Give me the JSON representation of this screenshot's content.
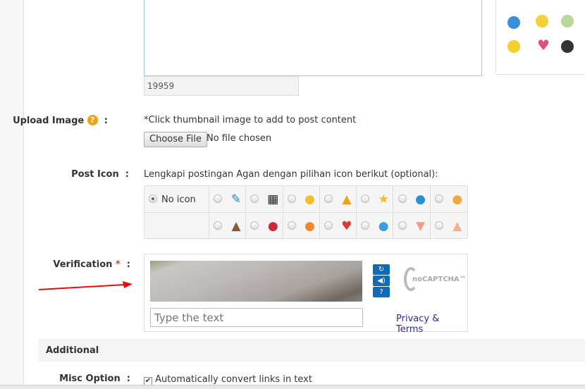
{
  "editor": {
    "char_count": "19959"
  },
  "upload": {
    "label": "Upload Image",
    "help": "?",
    "colon": ":",
    "hint": "*Click thumbnail image to add to post content",
    "button": "Choose File",
    "status": "No file chosen"
  },
  "post_icon": {
    "label": "Post Icon",
    "colon": ":",
    "hint": "Lengkapi postingan Agan dengan pilihan icon berikut (optional):",
    "no_icon": "No icon",
    "row1": [
      "pencil-icon",
      "clapper-icon",
      "lightbulb-icon",
      "warning-icon",
      "star-icon",
      "cool-face-icon",
      "smile-face-icon"
    ],
    "row2": [
      "poop-icon",
      "clown-face-icon",
      "laugh-face-icon",
      "heart-icon",
      "grin-face-icon",
      "thumbs-down-icon",
      "thumbs-up-icon"
    ]
  },
  "verification": {
    "label": "Verification",
    "required": "*",
    "colon": ":",
    "placeholder": "Type the text",
    "privacy": "Privacy & Terms",
    "brand": "noCAPTCHA™",
    "refresh": "↻",
    "audio": "◀)",
    "help": "?"
  },
  "additional": {
    "title": "Additional"
  },
  "misc": {
    "label": "Misc Option",
    "colon": ":",
    "option": "Automatically convert links in text",
    "checked": true
  },
  "colors": {
    "accent": "#0f6bb5",
    "link": "#2a2aa0",
    "arrow": "#e01010"
  }
}
